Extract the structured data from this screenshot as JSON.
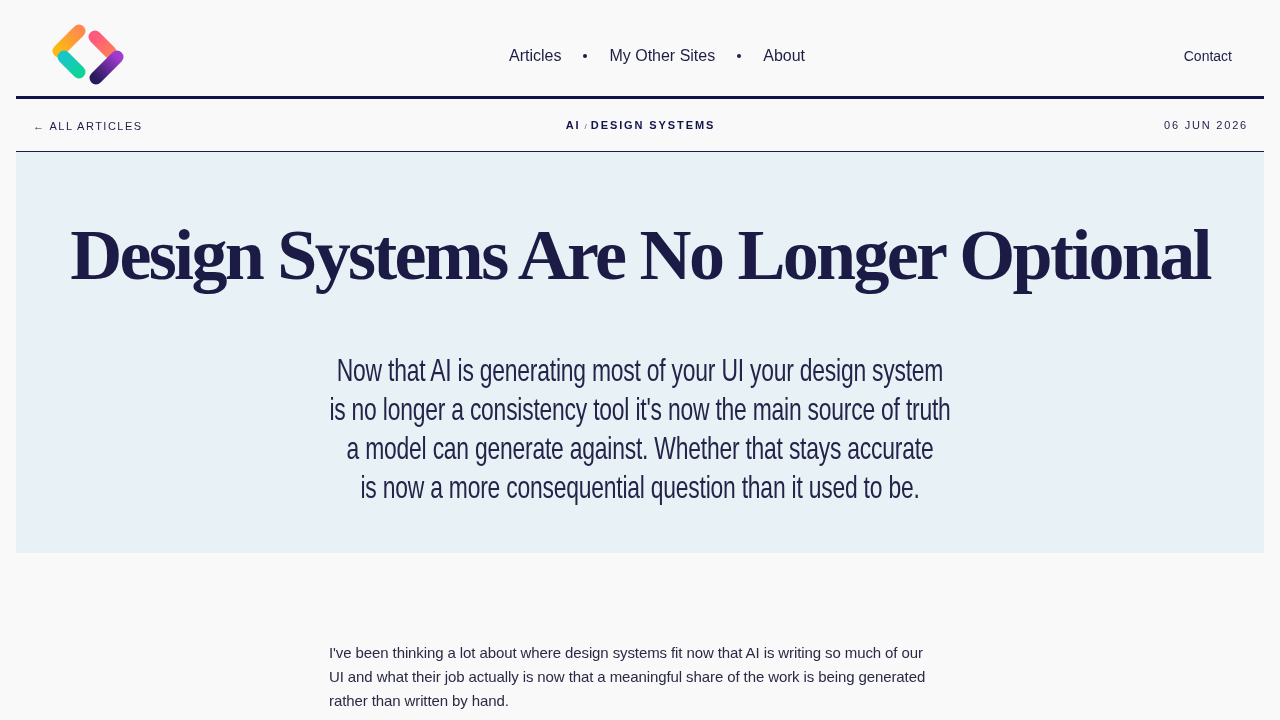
{
  "header": {
    "nav": [
      {
        "label": "Articles"
      },
      {
        "label": "My Other Sites"
      },
      {
        "label": "About"
      }
    ],
    "contact": "Contact"
  },
  "article_bar": {
    "back_link": "← ALL ARTICLES",
    "breadcrumb": [
      "AI",
      "DESIGN SYSTEMS"
    ],
    "separator": "/",
    "date": "06 JUN 2026"
  },
  "hero": {
    "title": "Design Systems Are No Longer Optional",
    "subtitle": "Now that AI is generating most of your UI your design system is no longer a consistency tool it's now the main source of truth a model can generate against. Whether that stays accurate is now a more consequential question than it used to be."
  },
  "body": {
    "paragraphs": [
      "I've been thinking a lot about where design systems fit now that AI is writing so much of our UI and what their job actually is now that a meaningful share of the work is being generated rather than written by hand."
    ]
  }
}
